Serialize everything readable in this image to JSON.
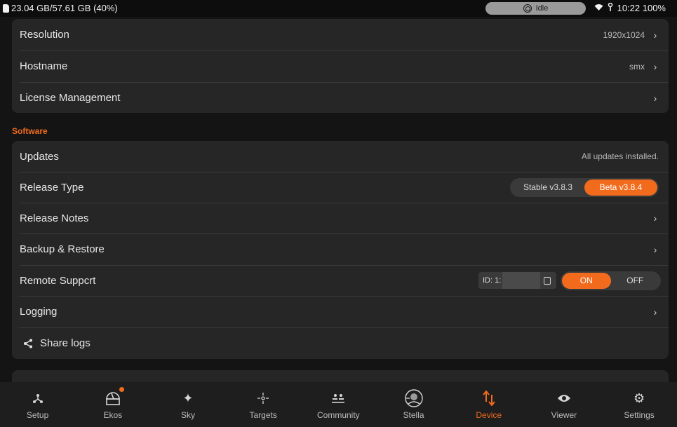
{
  "statusbar": {
    "storage": "23.04 GB/57.61 GB (40%)",
    "idle_label": "Idle",
    "time_battery": "10:22 100%"
  },
  "device_card": {
    "rows": [
      {
        "label": "Resolution",
        "value": "1920x1024"
      },
      {
        "label": "Hostname",
        "value": "smx"
      },
      {
        "label": "License Management",
        "value": ""
      }
    ]
  },
  "software": {
    "section_title": "Software",
    "updates": {
      "label": "Updates",
      "value": "All updates installed."
    },
    "release_type": {
      "label": "Release Type",
      "options": [
        "Stable v3.8.3",
        "Beta v3.8.4"
      ],
      "selected": "Beta v3.8.4"
    },
    "release_notes": {
      "label": "Release Notes"
    },
    "backup": {
      "label": "Backup & Restore"
    },
    "remote_support": {
      "label": "Remote Suppcrt",
      "id_prefix": "ID: 1:",
      "on_label": "ON",
      "off_label": "OFF",
      "selected": "ON"
    },
    "logging": {
      "label": "Logging"
    },
    "share_logs": {
      "label": "Share logs"
    }
  },
  "bottomnav": {
    "items": [
      {
        "label": "Setup",
        "icon": "setup-icon"
      },
      {
        "label": "Ekos",
        "icon": "observatory-icon"
      },
      {
        "label": "Sky",
        "icon": "sparkle-icon"
      },
      {
        "label": "Targets",
        "icon": "target-icon"
      },
      {
        "label": "Community",
        "icon": "community-icon"
      },
      {
        "label": "Stella",
        "icon": "stella-icon"
      },
      {
        "label": "Device",
        "icon": "transfer-arrows-icon"
      },
      {
        "label": "Viewer",
        "icon": "eye-icon"
      },
      {
        "label": "Settings",
        "icon": "gear-icon"
      }
    ],
    "active": "Device"
  },
  "colors": {
    "accent": "#f26b1d",
    "card": "#262626",
    "background": "#141414"
  }
}
